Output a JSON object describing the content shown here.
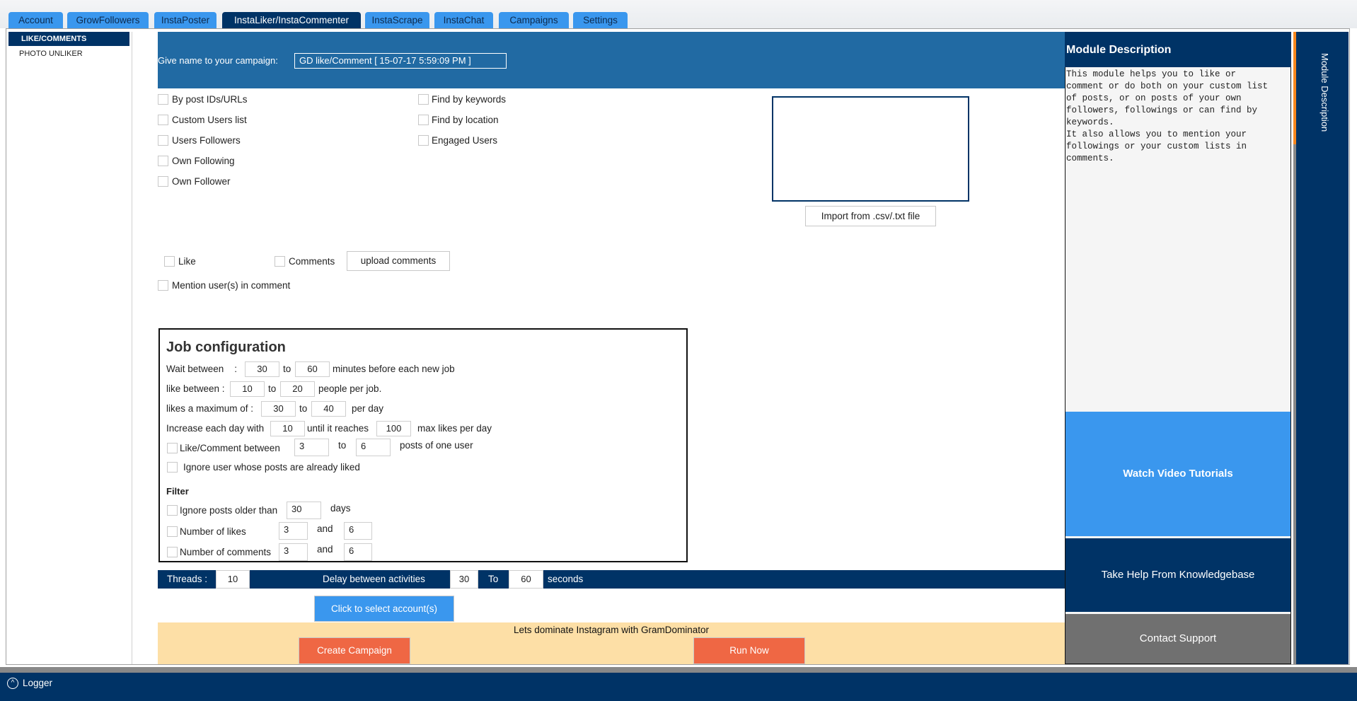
{
  "tabs": [
    "Account",
    "GrowFollowers",
    "InstaPoster",
    "InstaLiker/InstaCommenter",
    "InstaScrape",
    "InstaChat",
    "Campaigns",
    "Settings"
  ],
  "active_tab": "InstaLiker/InstaCommenter",
  "sidebar": {
    "items": [
      {
        "label": "LIKE/COMMENTS",
        "active": true
      },
      {
        "label": "PHOTO UNLIKER",
        "active": false
      }
    ]
  },
  "header": {
    "campaign_label": "Give name to your campaign:",
    "campaign_name": "GD like/Comment [ 15-07-17 5:59:09 PM ]"
  },
  "sources": {
    "col1": [
      "By post IDs/URLs",
      "Custom Users list",
      "Users Followers",
      "Own Following",
      "Own Follower"
    ],
    "col2": [
      "Find by keywords",
      "Find by location",
      "Engaged Users"
    ],
    "import_label": "Import from .csv/.txt file"
  },
  "actions": {
    "like": "Like",
    "comments": "Comments",
    "upload": "upload comments",
    "mention": "Mention user(s) in comment"
  },
  "job": {
    "title": "Job configuration",
    "wait": {
      "label": "Wait between    :",
      "from": "30",
      "to_label": "to",
      "to": "60",
      "suffix": "minutes before each new job"
    },
    "like_between": {
      "label": "like between :",
      "from": "10",
      "to_label": "to",
      "to": "20",
      "suffix": "people per job."
    },
    "max": {
      "label": "likes a maximum of :",
      "from": "30",
      "to_label": "to",
      "to": "40",
      "suffix": "per day"
    },
    "increase": {
      "label": "Increase each day with",
      "value": "10",
      "until_label": "until it reaches",
      "until": "100",
      "suffix": "max likes per day"
    },
    "like_comment": {
      "label": "Like/Comment between",
      "from": "3",
      "to_label": "to",
      "to": "6",
      "suffix": "posts of one user"
    },
    "ignore_liked": "Ignore user whose posts are already liked",
    "filter": {
      "title": "Filter",
      "older": {
        "label": "Ignore posts older than",
        "value": "30",
        "suffix": "days"
      },
      "likes": {
        "label": "Number of likes",
        "from": "3",
        "and": "and",
        "to": "6"
      },
      "comments": {
        "label": "Number of comments",
        "from": "3",
        "and": "and",
        "to": "6"
      }
    }
  },
  "threads": {
    "label": "Threads :",
    "value": "10",
    "delay_label": "Delay between activities",
    "delay_from": "30",
    "to_label": "To",
    "delay_to": "60",
    "suffix": "seconds"
  },
  "select_accounts": "Click to select account(s)",
  "footer": {
    "slogan": "Lets dominate Instagram with GramDominator",
    "create": "Create Campaign",
    "run": "Run Now"
  },
  "right": {
    "title": "Module Description",
    "description": "This module helps you to like or\ncomment or do both on your custom list\nof posts, or on posts of your own\nfollowers, followings or can find by\nkeywords.\nIt also allows you to mention your\nfollowings or your custom lists in\ncomments.",
    "video": "Watch Video Tutorials",
    "kb": "Take Help From Knowledgebase",
    "support": "Contact Support",
    "vertical_tab": "Module Description"
  },
  "logger": "Logger",
  "colors": {
    "navy": "#003366",
    "header_blue": "#216aa3",
    "tab_blue": "#3a97ee",
    "orange": "#ef6744",
    "beige": "#fddfa6",
    "grey": "#707070"
  }
}
